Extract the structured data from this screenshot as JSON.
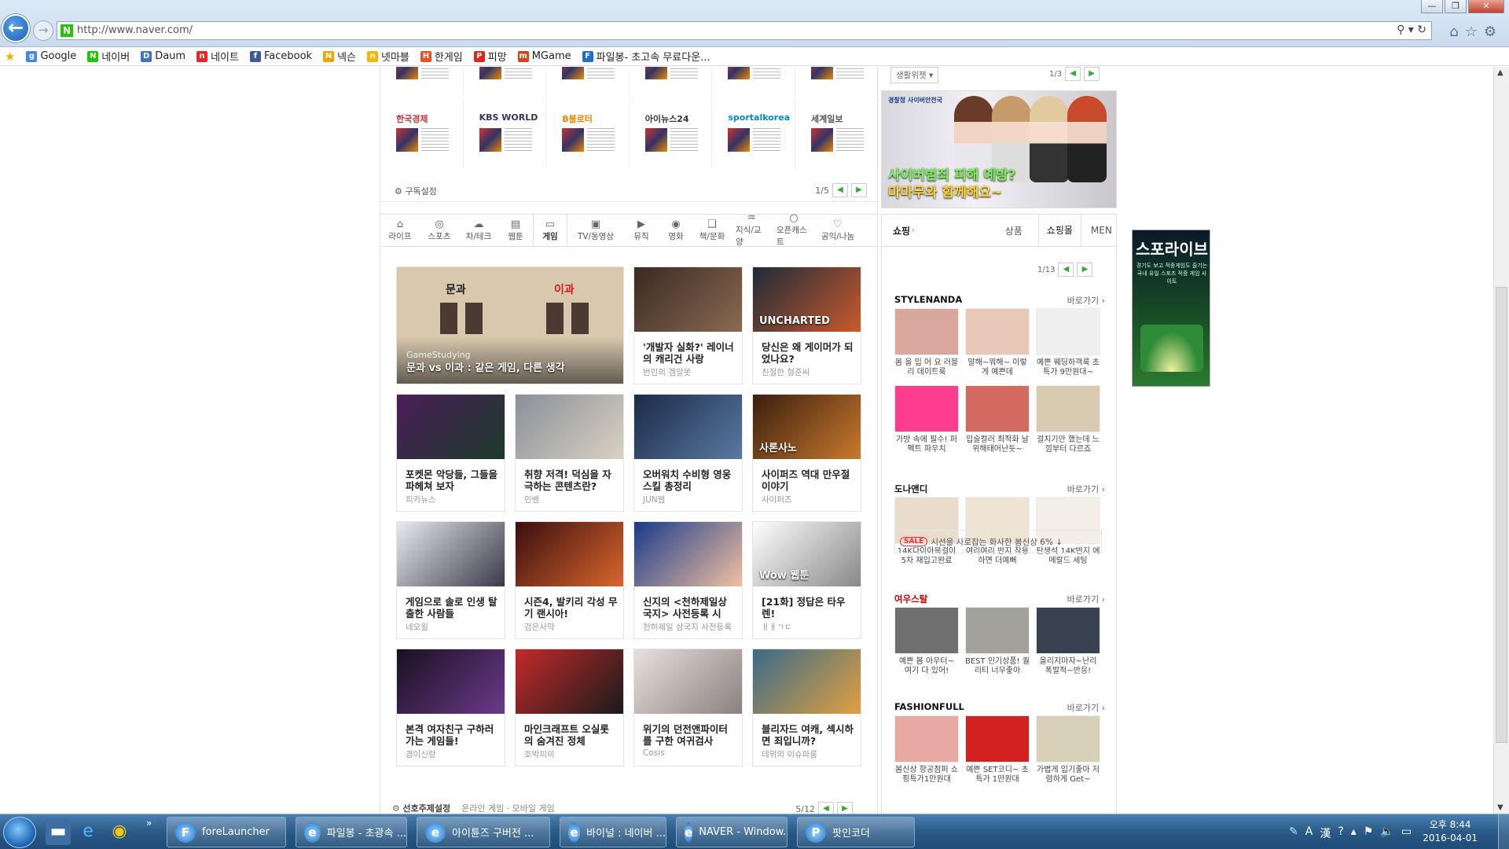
{
  "browser": {
    "url": "http://www.naver.com/",
    "window_controls": [
      "—",
      "❐",
      "✕"
    ]
  },
  "favorites": [
    {
      "label": "Google",
      "color": "#4285f4",
      "glyph": "g"
    },
    {
      "label": "네이버",
      "color": "#1ec800",
      "glyph": "N"
    },
    {
      "label": "Daum",
      "color": "#3f6fd1",
      "glyph": "D"
    },
    {
      "label": "네이트",
      "color": "#e8262a",
      "glyph": "n"
    },
    {
      "label": "Facebook",
      "color": "#3b5998",
      "glyph": "f"
    },
    {
      "label": "넥슨",
      "color": "#f0a400",
      "glyph": "N"
    },
    {
      "label": "넷마블",
      "color": "#f7b500",
      "glyph": "n"
    },
    {
      "label": "한게임",
      "color": "#f04e23",
      "glyph": "H"
    },
    {
      "label": "피망",
      "color": "#e2231a",
      "glyph": "P"
    },
    {
      "label": "MGame",
      "color": "#d2471a",
      "glyph": "m"
    },
    {
      "label": "파일봉- 초고속 무료다운...",
      "color": "#1a6fd0",
      "glyph": "F"
    }
  ],
  "press": {
    "row2": [
      "한국경제",
      "KBS WORLD",
      "B블로터",
      "아이뉴스24",
      "sportalkorea",
      "세계일보"
    ],
    "settings_label": "구독설정",
    "page": "1/5"
  },
  "widget": {
    "select_label": "생활위젯",
    "page": "1/3",
    "banner_line1": "사이버범죄 피해 예방?",
    "banner_line2": "마마무와 함께해요~",
    "banner_logo": "경찰청 사이버안전국"
  },
  "tabs": [
    {
      "label": "라이프",
      "icon": "⌂"
    },
    {
      "label": "스포츠",
      "icon": "◎"
    },
    {
      "label": "차/테크",
      "icon": "☁"
    },
    {
      "label": "웹툰",
      "icon": "▤"
    },
    {
      "label": "게임",
      "icon": "▭",
      "active": true
    },
    {
      "label": "TV/동영상",
      "icon": "▣"
    },
    {
      "label": "뮤직",
      "icon": "▶"
    },
    {
      "label": "영화",
      "icon": "◉"
    },
    {
      "label": "책/문화",
      "icon": "❑"
    },
    {
      "label": "지식/교양",
      "icon": "♒"
    },
    {
      "label": "오픈캐스트",
      "icon": "○"
    },
    {
      "label": "공익/나눔",
      "icon": "♡"
    }
  ],
  "feature": {
    "tag": "GameStudying",
    "title": "문과 vs 이과 : 같은 게임, 다른 생각",
    "panel_left": "문과",
    "panel_right": "이과"
  },
  "cards": [
    {
      "title": "'개발자 실화?' 레이너의 캐리건 사랑",
      "source": "번민의 겜알못"
    },
    {
      "title": "당신은 왜 게이머가 되었나요?",
      "source": "친절한 형준씨",
      "overlay": "UNCHARTED"
    },
    {
      "title": "포켓몬 악당들, 그들을 파헤쳐 보자",
      "source": "피카뉴스"
    },
    {
      "title": "취향 저격! 덕심을 자극하는 콘텐츠란?",
      "source": "인벤"
    },
    {
      "title": "오버워치 수비형 영웅 스킬 총정리",
      "source": "JUN웹"
    },
    {
      "title": "사이퍼즈 역대 만우절 이야기",
      "source": "사이퍼즈",
      "overlay": "사론사노"
    },
    {
      "title": "게임으로 솔로 인생 탈출한 사람들",
      "source": "네오윌"
    },
    {
      "title": "시즌4, 발키리 각성 무기 랜시아!",
      "source": "검은사막"
    },
    {
      "title": "신지의 <천하제일상 국지> 사전등록 시",
      "source": "천하제일 삼국지 사전등록"
    },
    {
      "title": "[21화] 정답은 타우렌!",
      "source": "ㅐㅐㄱㄷ",
      "overlay": "Wow 웹툰"
    },
    {
      "title": "본격 여자친구 구하러 가는 게임들!",
      "source": "경이신랑"
    },
    {
      "title": "마인크래프트 오실롯의 숨겨진 정체",
      "source": "호박피이"
    },
    {
      "title": "위기의 던전앤파이터를 구한 여귀검사",
      "source": "Cosis"
    },
    {
      "title": "블리자드 여캐, 섹시하면 죄입니까?",
      "source": "데위의 이슈파룸"
    }
  ],
  "grid_footer": {
    "settings_label": "선호주제설정",
    "links": "온라인 게임 · 모바일 게임",
    "page": "5/12"
  },
  "shop": {
    "tabs": [
      "쇼핑",
      "상품",
      "쇼핑몰",
      "MEN"
    ],
    "page": "1/13",
    "more_label": "바로가기",
    "sections": [
      {
        "brand": "STYLENANDA",
        "items": [
          {
            "caption": "봄 을 입 어 요 러블리 데이트룩",
            "color": "#d9a79b"
          },
          {
            "caption": "말해~뭐해~ 이렇게 예쁜데",
            "color": "#e8c9b8"
          },
          {
            "caption": "예쁜 웨딩하객룩 초특가 9만원대~",
            "color": "#efefef"
          },
          {
            "caption": "가방 속에 필수! 퍼펙트 파우치",
            "color": "#ff3d8e"
          },
          {
            "caption": "입술컬러 최적화 날위해태어난듯~",
            "color": "#d46a5f"
          },
          {
            "caption": "걸치기만 했는데 느낌부터 다르죠",
            "color": "#d9cbb2"
          }
        ]
      },
      {
        "brand": "도나앤디",
        "items": [
          {
            "caption": "14K다이아목걸이 5차 재입고완료",
            "color": "#e9dccd"
          },
          {
            "caption": "여리여리 반지 착용하면 더예뻐",
            "color": "#efe3d3"
          },
          {
            "caption": "탄생석 14K반지 에메랄드 세팅",
            "color": "#f3eee6"
          }
        ]
      },
      {
        "brand": "여우스탈",
        "items": [
          {
            "caption": "예쁜 봄 아우터~ 여기 다 있어!",
            "color": "#6f6f6f"
          },
          {
            "caption": "BEST 인기상품! 퀄리티 너무좋아",
            "color": "#a3a19b"
          },
          {
            "caption": "올리지마자~난리 폭발적~반응!",
            "color": "#38414f"
          }
        ]
      },
      {
        "brand": "FASHIONFULL",
        "items": [
          {
            "caption": "봄신상 항공점퍼 쇼핑특가1만원대",
            "color": "#e8a9a3"
          },
          {
            "caption": "예쁜 SET코디~ 초특가 1만원대",
            "color": "#d32020"
          },
          {
            "caption": "가볍게 입기좋아 저렴하게 Get~",
            "color": "#d8cfb7"
          }
        ]
      }
    ],
    "sale_badge": "SALE",
    "sale_text": "시선을 사로잡는 화사한 봄신상 6% ↓"
  },
  "side_ad": {
    "title": "스포라이브",
    "subtitle": "경기도 보고 적중게임도 즐기는 국내 유일 스포츠 적중 게임 사이트"
  },
  "taskbar": {
    "tasks": [
      {
        "label": "foreLauncher",
        "icon": "F"
      },
      {
        "label": "파일봉 - 초광속 ...",
        "icon": "e"
      },
      {
        "label": "아이튠즈 구버전 ...",
        "icon": "e"
      },
      {
        "label": "바이널 : 네이버 ...",
        "icon": "e"
      },
      {
        "label": "NAVER - Window...",
        "icon": "e"
      },
      {
        "label": "팟인코더",
        "icon": "P"
      }
    ],
    "time": "오후 8:44",
    "date": "2016-04-01",
    "ime_label": "A",
    "ime_label2": "漢"
  }
}
